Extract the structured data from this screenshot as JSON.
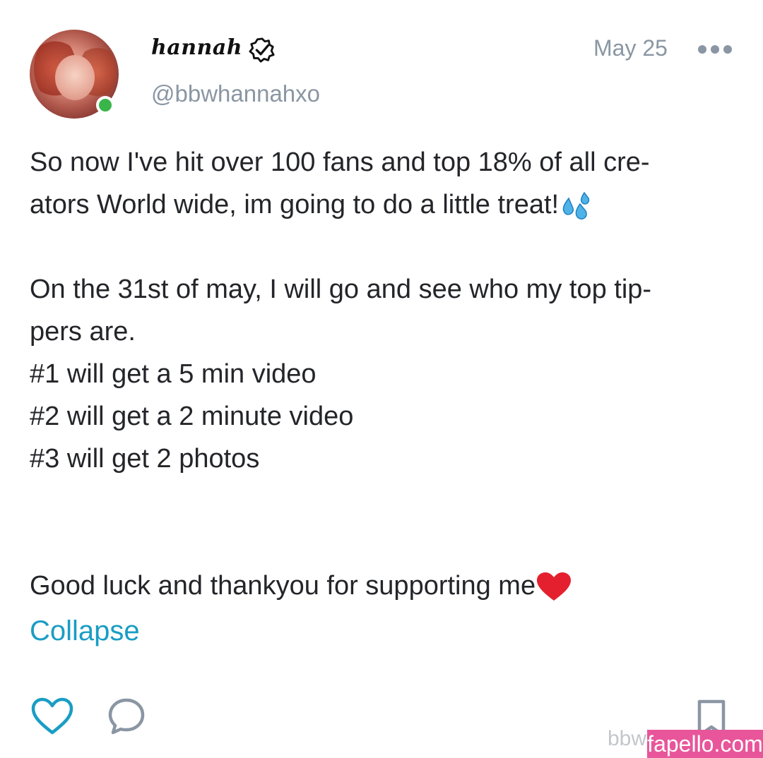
{
  "post": {
    "author": {
      "display_name": "hannah",
      "handle": "@bbwhannahxo",
      "verified": true,
      "online": true
    },
    "date": "May 25",
    "body_lines": [
      "So now I've hit over 100 fans and top 18% of all cre-",
      "ators World wide, im going to do a little treat!",
      "",
      "On the 31st of may, I will go and see who my top tip-",
      "pers are.",
      "#1 will get a 5 min video",
      "#2 will get a 2 minute video",
      "#3 will get 2 photos",
      "",
      "",
      "Good luck and thankyou for supporting me"
    ],
    "collapse_label": "Collapse"
  },
  "actions": {
    "like_icon": "heart-icon",
    "comment_icon": "comment-icon",
    "bookmark_icon": "bookmark-icon"
  },
  "watermark": {
    "partial_text": "bbw",
    "site": "fapello.com"
  },
  "colors": {
    "link": "#1a9dc4",
    "muted": "#8a96a3",
    "online": "#3ab54a",
    "watermark_bg": "#e8559a"
  }
}
